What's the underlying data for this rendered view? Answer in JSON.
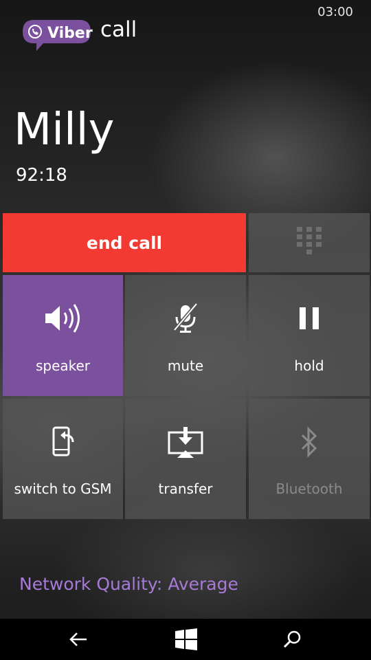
{
  "status_bar": {
    "time": "03:00"
  },
  "header": {
    "logo_text": "Viber",
    "section_title": "call",
    "brand_color": "#7b519d"
  },
  "caller": {
    "name": "Milly",
    "duration": "92:18"
  },
  "actions": {
    "end_call": {
      "label": "end call",
      "color": "#f23a32"
    },
    "keypad": {
      "icon": "keypad-icon"
    },
    "speaker": {
      "label": "speaker",
      "icon": "speaker-icon",
      "active": true,
      "active_color": "#7b519d"
    },
    "mute": {
      "label": "mute",
      "icon": "mic-off-icon"
    },
    "hold": {
      "label": "hold",
      "icon": "pause-icon"
    },
    "switch_to_gsm": {
      "label": "switch to GSM",
      "icon": "phone-switch-icon"
    },
    "transfer": {
      "label": "transfer",
      "icon": "transfer-icon"
    },
    "bluetooth": {
      "label": "Bluetooth",
      "icon": "bluetooth-icon",
      "enabled": false
    }
  },
  "network": {
    "quality_text": "Network Quality: Average",
    "text_color": "#a67ad6"
  },
  "navbar": {
    "back": "back-arrow-icon",
    "start": "windows-icon",
    "search": "search-icon"
  }
}
